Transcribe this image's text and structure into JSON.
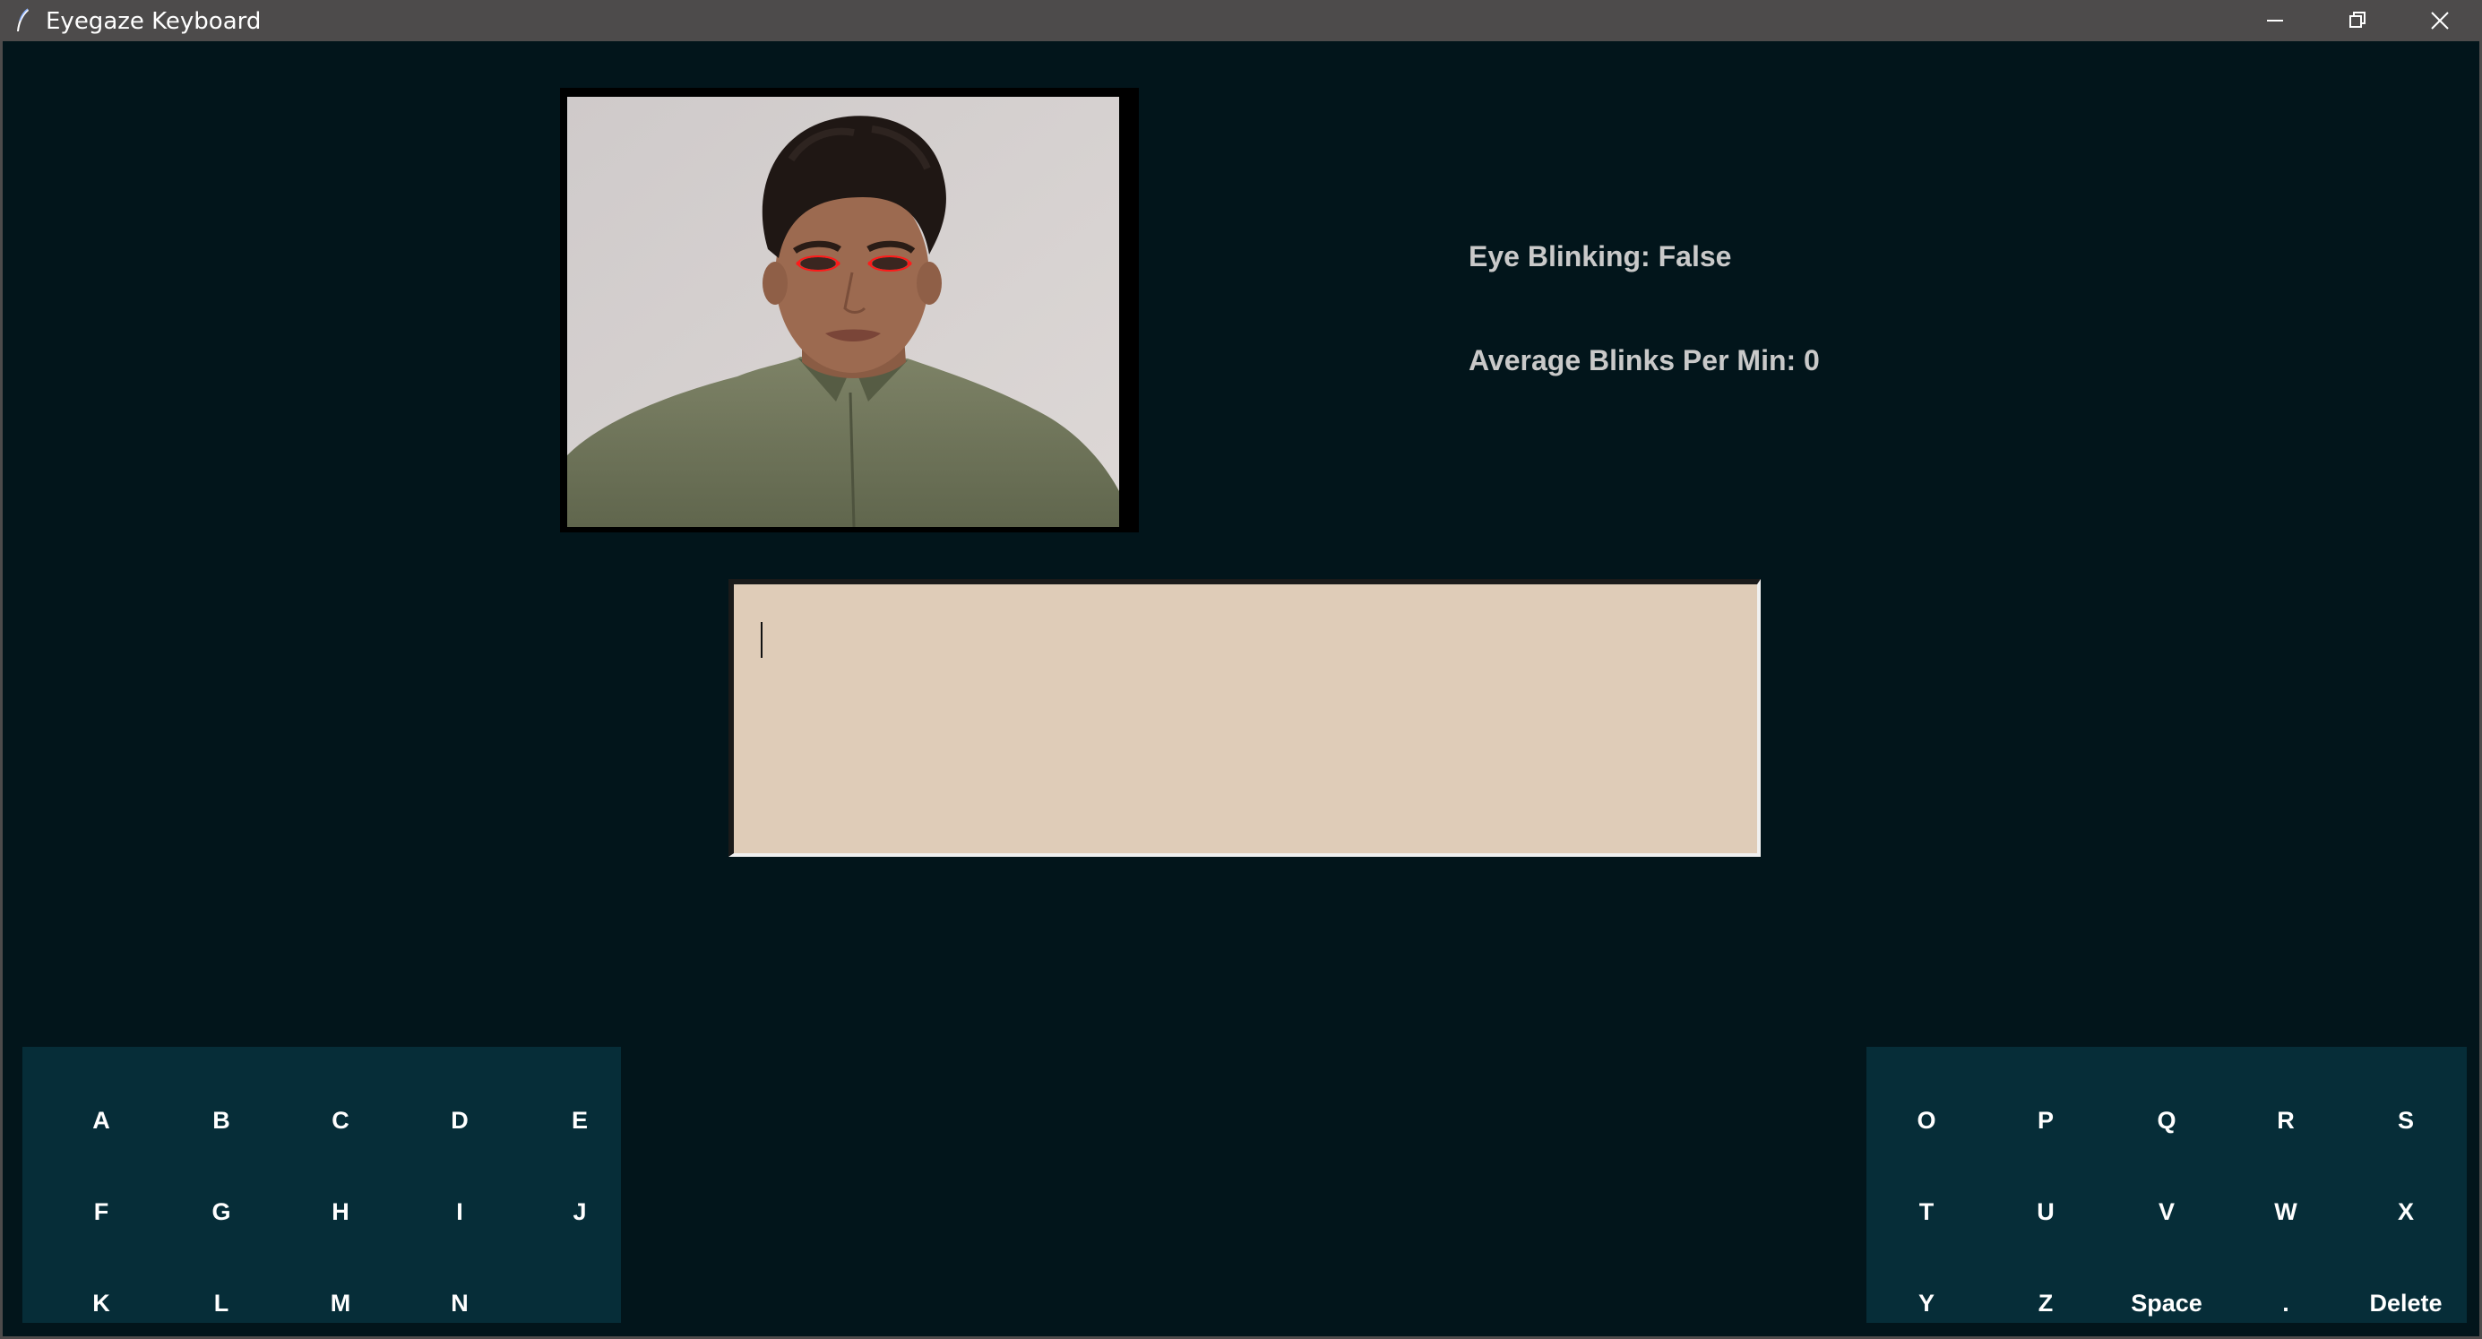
{
  "window": {
    "title": "Eyegaze Keyboard"
  },
  "status": {
    "eye_blinking": "Eye Blinking: False",
    "average_blinks": "Average Blinks Per Min: 0"
  },
  "text_area": {
    "value": ""
  },
  "keyboard": {
    "left": [
      [
        "A",
        "B",
        "C",
        "D",
        "E"
      ],
      [
        "F",
        "G",
        "H",
        "I",
        "J"
      ],
      [
        "K",
        "L",
        "M",
        "N"
      ]
    ],
    "right": [
      [
        "O",
        "P",
        "Q",
        "R",
        "S"
      ],
      [
        "T",
        "U",
        "V",
        "W",
        "X"
      ],
      [
        "Y",
        "Z",
        "Space",
        ".",
        "Delete"
      ]
    ]
  },
  "colors": {
    "background": "#02151b",
    "keypad": "#062d38",
    "text_area": "#dfccb8",
    "titlebar": "#4d4b4b",
    "status_text": "#c9c9c9",
    "eye_landmarks": "#ff1a1a"
  },
  "icons": {
    "app": "feather-icon",
    "minimize": "minimize-icon",
    "restore": "restore-icon",
    "close": "close-icon"
  }
}
